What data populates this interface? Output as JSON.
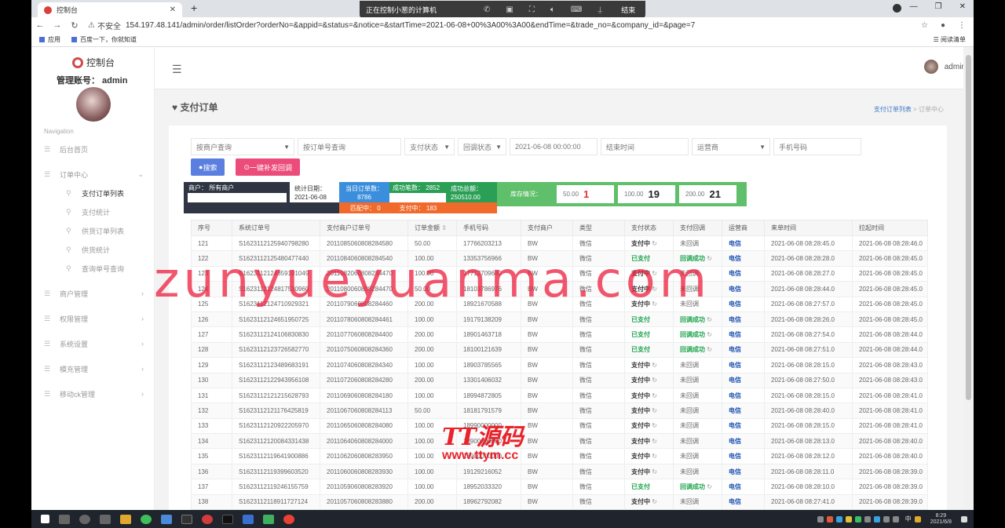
{
  "browser": {
    "tab_title": "控制台",
    "insecure_label": "不安全",
    "url": "154.197.48.141/admin/order/listOrder?orderNo=&appid=&status=&notice=&startTime=2021-06-08+00%3A00%3A00&endTime=&trade_no=&company_id=&page=7",
    "bookmarks": [
      "应用",
      "百度一下，你就知道"
    ],
    "reading_list": "阅读清单"
  },
  "call_bar": {
    "text": "正在控制小葱的计算机",
    "end_label": "结束"
  },
  "sidebar": {
    "logo_text": "控制台",
    "account": "管理账号：  admin",
    "nav_title": "Navigation",
    "items": [
      {
        "label": "后台首页",
        "icon": "home-icon",
        "chev": ""
      },
      {
        "label": "订单中心",
        "icon": "order-icon",
        "chev": "⌄"
      }
    ],
    "sub_items": [
      "支付订单列表",
      "支付统计",
      "供货订单列表",
      "供货统计",
      "查询单号查询"
    ],
    "items2": [
      {
        "label": "商户管理",
        "chev": "›"
      },
      {
        "label": "权限管理",
        "chev": "›"
      },
      {
        "label": "系统设置",
        "chev": "›"
      },
      {
        "label": "模充管理",
        "chev": "›"
      },
      {
        "label": "移动ck管理",
        "chev": "›"
      }
    ]
  },
  "header": {
    "user": "admin"
  },
  "page": {
    "title": "支付订单",
    "breadcrumb_link": "支付订单列表",
    "breadcrumb_sep": ">",
    "breadcrumb_current": "订单中心"
  },
  "filters": {
    "merchant": "按商户查询",
    "order_no": "按订单号查询",
    "pay_status": "支付状态",
    "callback": "回调状态",
    "start_time": "2021-06-08 00:00:00",
    "end_time": "结束时间",
    "operator": "运营商",
    "phone": "手机号码",
    "search_btn": "搜索",
    "resend_btn": "一键补发回调"
  },
  "stats": {
    "merchant": "商户：  所有商户",
    "date_label": "统计日期：",
    "date_value": "2021-06-08",
    "today_label": "当日订单数：",
    "today_value": "8786",
    "success_label": "成功笔数：  2852",
    "amount_label": "成功总额：",
    "amount_value": "250510.00",
    "matching": "匹配中：  0",
    "paying": "支付中：  183"
  },
  "stock": {
    "label": "库存情况：",
    "boxes": [
      {
        "amount": "50.00",
        "count": "1"
      },
      {
        "amount": "100.00",
        "count": "19"
      },
      {
        "amount": "200.00",
        "count": "21"
      }
    ]
  },
  "table": {
    "headers": [
      "序号",
      "系统订单号",
      "支付商户订单号",
      "订单金额",
      "手机号码",
      "支付商户",
      "类型",
      "支付状态",
      "支付回调",
      "运营商",
      "来单时间",
      "拉起时间"
    ],
    "amount_sort_icon": "⇕",
    "rows": [
      [
        "121",
        "S1623112125940798280",
        "2011085060808284580",
        "50.00",
        "17766203213",
        "BW",
        "微信",
        "支付中",
        "未回调",
        "电信",
        "2021-06-08 08:28:45.0",
        "2021-06-08 08:28:46.0"
      ],
      [
        "122",
        "S1623112125480477440",
        "2011084060808284540",
        "100.00",
        "13353756966",
        "BW",
        "微信",
        "已支付",
        "回调成功",
        "电信",
        "2021-06-08 08:28:28.0",
        "2021-06-08 08:28:45.0"
      ],
      [
        "123",
        "S1623112124859101049",
        "2011082060808284470",
        "100.00",
        "17712709680",
        "BW",
        "微信",
        "支付中",
        "未回调",
        "电信",
        "2021-06-08 08:28:27.0",
        "2021-06-08 08:28:45.0"
      ],
      [
        "124",
        "S1623112124817530960",
        "2011080060808284470",
        "50.00",
        "18103786976",
        "BW",
        "微信",
        "支付中",
        "未回调",
        "电信",
        "2021-06-08 08:28:44.0",
        "2021-06-08 08:28:45.0"
      ],
      [
        "125",
        "S1623112124710929321",
        "2011079060808284460",
        "200.00",
        "18921670588",
        "BW",
        "微信",
        "支付中",
        "未回调",
        "电信",
        "2021-06-08 08:27:57.0",
        "2021-06-08 08:28:45.0"
      ],
      [
        "126",
        "S1623112124651950725",
        "2011078060808284461",
        "100.00",
        "19179138209",
        "BW",
        "微信",
        "已支付",
        "回调成功",
        "电信",
        "2021-06-08 08:28:26.0",
        "2021-06-08 08:28:45.0"
      ],
      [
        "127",
        "S1623112124106830830",
        "2011077060808284400",
        "200.00",
        "18901463718",
        "BW",
        "微信",
        "已支付",
        "回调成功",
        "电信",
        "2021-06-08 08:27:54.0",
        "2021-06-08 08:28:44.0"
      ],
      [
        "128",
        "S1623112123726582770",
        "2011075060808284360",
        "200.00",
        "18100121639",
        "BW",
        "微信",
        "已支付",
        "回调成功",
        "电信",
        "2021-06-08 08:27:51.0",
        "2021-06-08 08:28:44.0"
      ],
      [
        "129",
        "S1623112123489683191",
        "2011074060808284340",
        "100.00",
        "18903785565",
        "BW",
        "微信",
        "支付中",
        "未回调",
        "电信",
        "2021-06-08 08:28:15.0",
        "2021-06-08 08:28:43.0"
      ],
      [
        "130",
        "S1623112122943956108",
        "2011072060808284280",
        "200.00",
        "13301406032",
        "BW",
        "微信",
        "支付中",
        "未回调",
        "电信",
        "2021-06-08 08:27:50.0",
        "2021-06-08 08:28:43.0"
      ],
      [
        "131",
        "S1623112121215628793",
        "2011069060808284180",
        "100.00",
        "18994872805",
        "BW",
        "微信",
        "支付中",
        "未回调",
        "电信",
        "2021-06-08 08:28:15.0",
        "2021-06-08 08:28:41.0"
      ],
      [
        "132",
        "S1623112121176425819",
        "2011067060808284113",
        "50.00",
        "18181791579",
        "BW",
        "微信",
        "支付中",
        "未回调",
        "电信",
        "2021-06-08 08:28:40.0",
        "2021-06-08 08:28:41.0"
      ],
      [
        "133",
        "S1623112120922205970",
        "2011065060808284080",
        "100.00",
        "18990000000",
        "BW",
        "微信",
        "支付中",
        "未回调",
        "电信",
        "2021-06-08 08:28:15.0",
        "2021-06-08 08:28:41.0"
      ],
      [
        "134",
        "S1623112120084331438",
        "2011064060808284000",
        "100.00",
        "18900000000",
        "BW",
        "微信",
        "支付中",
        "未回调",
        "电信",
        "2021-06-08 08:28:13.0",
        "2021-06-08 08:28:40.0"
      ],
      [
        "135",
        "S1623112119641900886",
        "2011062060808283950",
        "100.00",
        "18900000000",
        "BW",
        "微信",
        "支付中",
        "未回调",
        "电信",
        "2021-06-08 08:28:12.0",
        "2021-06-08 08:28:40.0"
      ],
      [
        "136",
        "S1623112119399603520",
        "2011060060808283930",
        "100.00",
        "19129216052",
        "BW",
        "微信",
        "支付中",
        "未回调",
        "电信",
        "2021-06-08 08:28:11.0",
        "2021-06-08 08:28:39.0"
      ],
      [
        "137",
        "S1623112119246155759",
        "2011059060808283920",
        "100.00",
        "18952033320",
        "BW",
        "微信",
        "已支付",
        "回调成功",
        "电信",
        "2021-06-08 08:28:10.0",
        "2021-06-08 08:28:39.0"
      ],
      [
        "138",
        "S1623112118911727124",
        "2011057060808283880",
        "200.00",
        "18962792082",
        "BW",
        "微信",
        "支付中",
        "未回调",
        "电信",
        "2021-06-08 08:27:41.0",
        "2021-06-08 08:28:39.0"
      ]
    ]
  },
  "watermark": {
    "big": "zunyueyuanma.com",
    "logo_top": "TT源码",
    "logo_url": "www.ttym.cc"
  },
  "taskbar": {
    "time": "8:29",
    "date": "2021/6/8",
    "ime": "中"
  },
  "colors": {
    "accent": "#5a7fe0",
    "danger": "#ec4c7a",
    "success": "#1aa34a",
    "stock": "#5fbf6a"
  }
}
